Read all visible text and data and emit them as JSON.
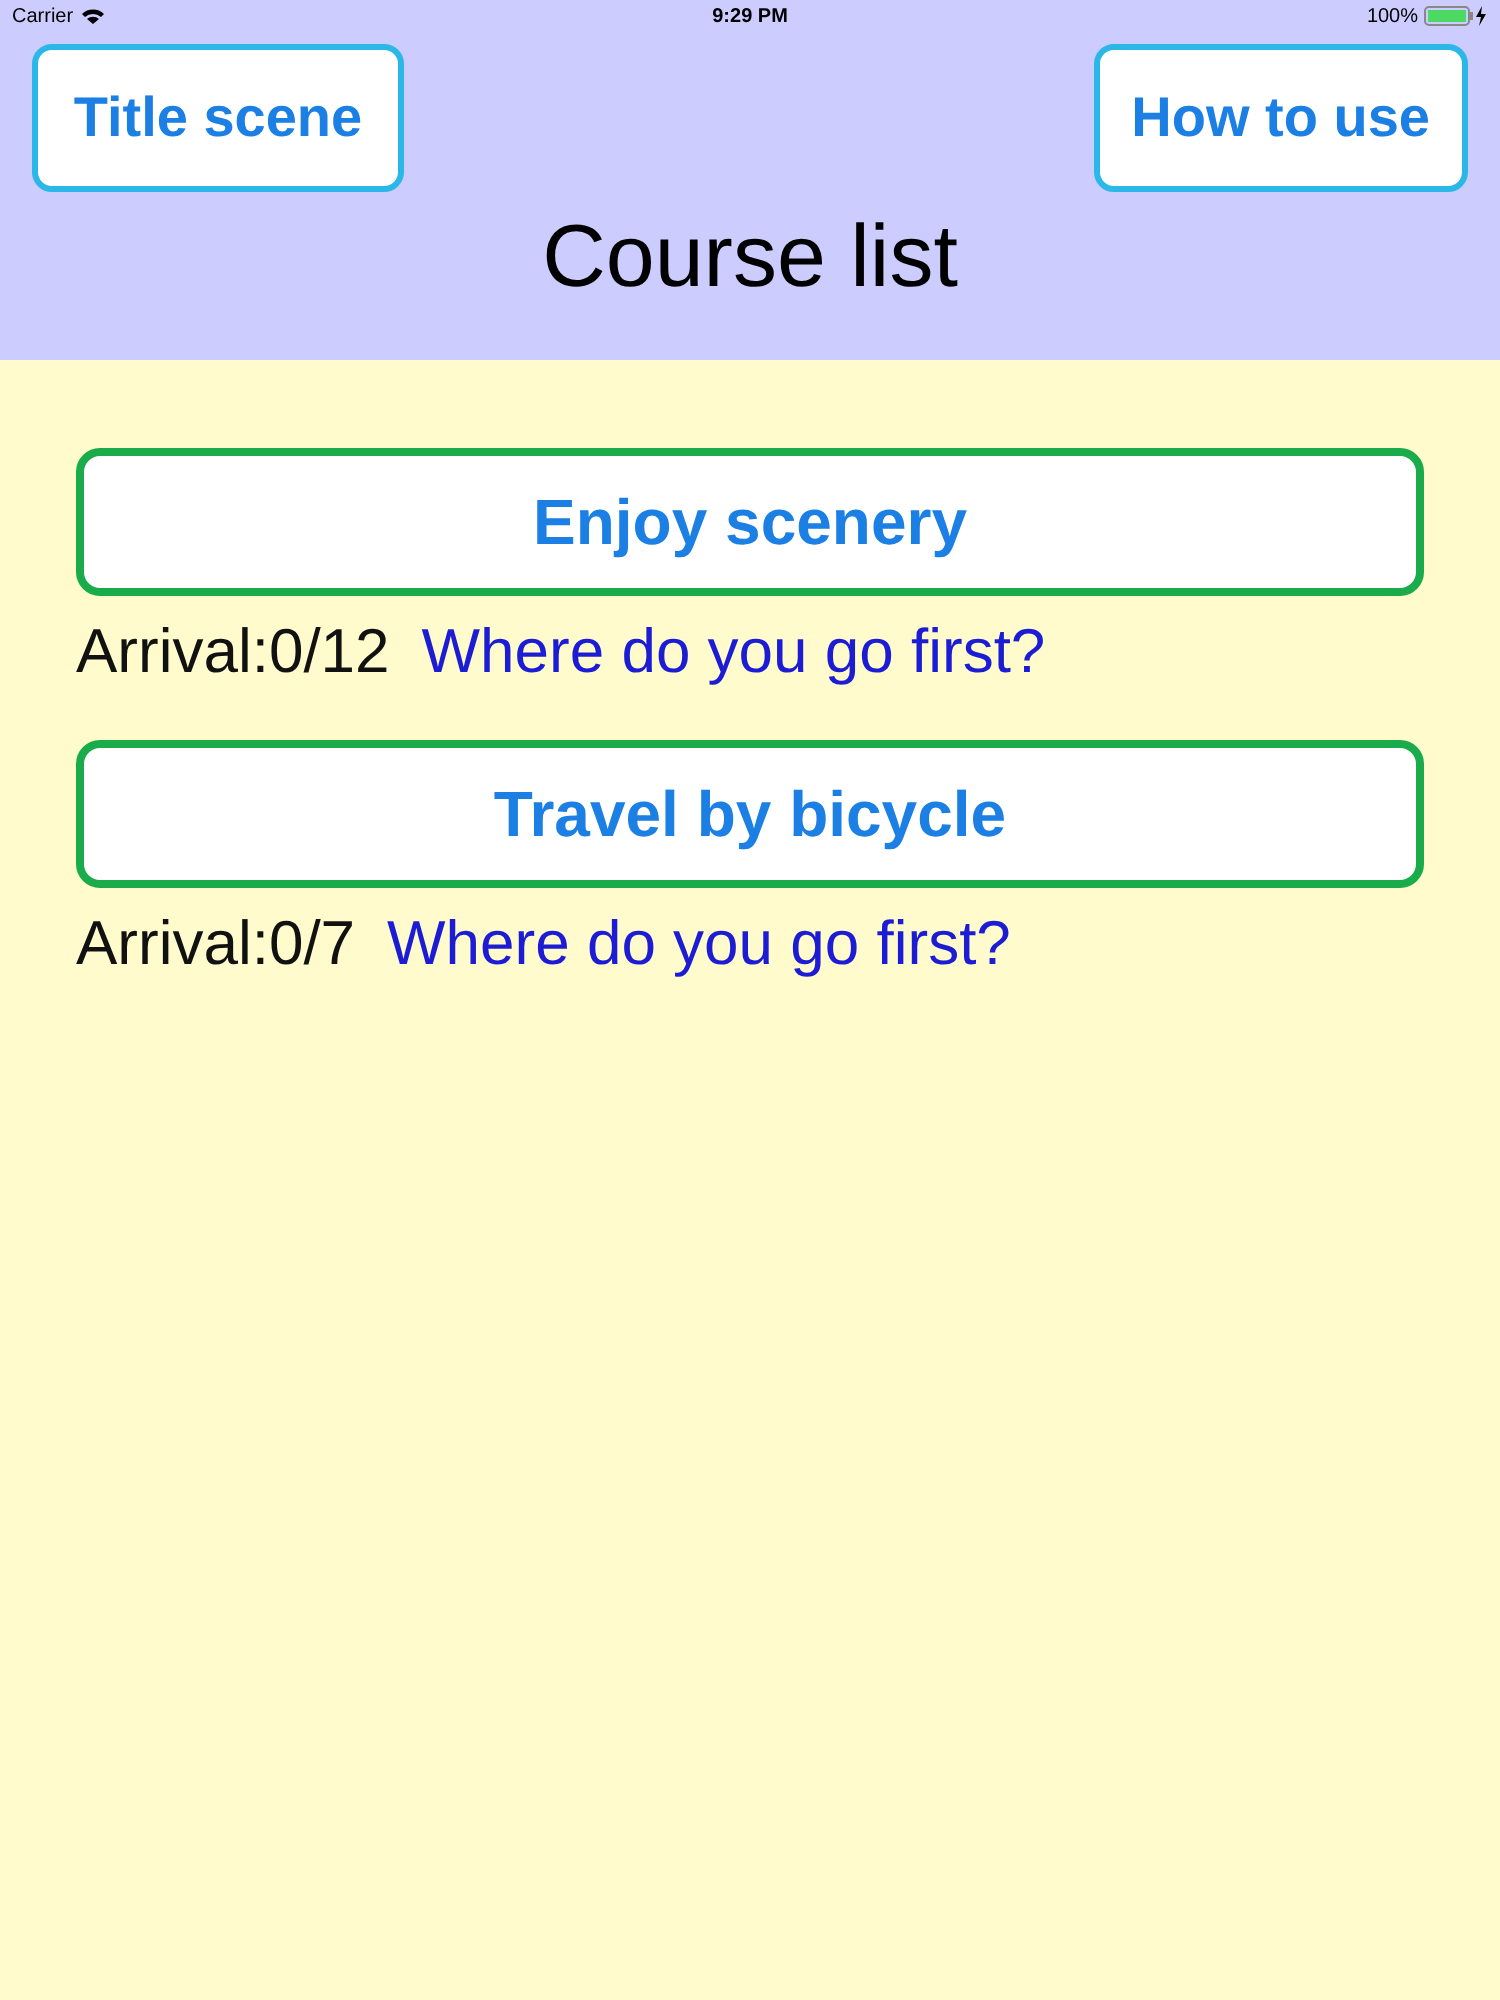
{
  "status_bar": {
    "carrier": "Carrier",
    "time": "9:29 PM",
    "battery": "100%"
  },
  "header": {
    "buttons": [
      "Title scene",
      "How to use"
    ],
    "title": "Course list"
  },
  "courses": [
    {
      "name": "Enjoy scenery",
      "arrival": "Arrival:0/12",
      "hint": "Where do you go first?"
    },
    {
      "name": "Travel by bicycle",
      "arrival": "Arrival:0/7",
      "hint": "Where do you go first?"
    }
  ]
}
